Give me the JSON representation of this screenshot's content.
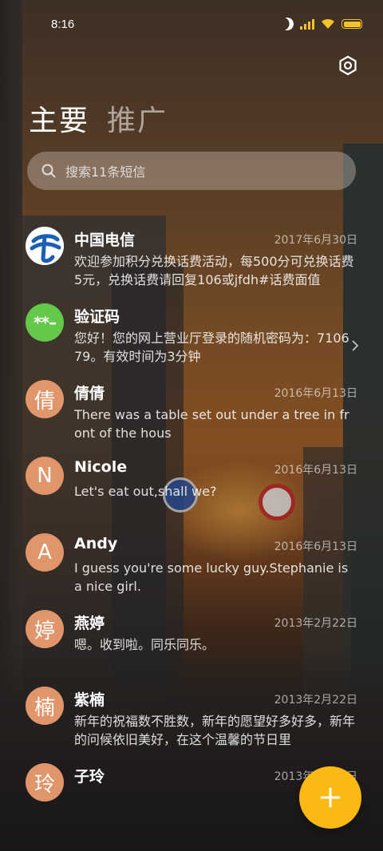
{
  "status_bar": {
    "time": "8:16",
    "icons": [
      "moon-icon",
      "signal-icon",
      "wifi-icon",
      "battery-icon"
    ],
    "accent_color": "#f5c22a"
  },
  "header": {
    "settings_icon": "gear-icon",
    "tabs": [
      {
        "label": "主要",
        "active": true
      },
      {
        "label": "推广",
        "active": false
      }
    ]
  },
  "search": {
    "placeholder": "搜索11条短信",
    "icon": "search-icon"
  },
  "messages": [
    {
      "avatar_text": "",
      "avatar_type": "telecom-logo",
      "name": "中国电信",
      "date": "2017年6月30日",
      "snippet": "欢迎参加积分兑换话费活动，每500分可兑换话费5元，兑换话费请回复106或jfdh#话费面值"
    },
    {
      "avatar_text": "**–",
      "avatar_type": "verification",
      "name": "验证码",
      "date": "",
      "snippet": "您好！您的网上营业厅登录的随机密码为：710679。有效时间为3分钟",
      "has_chevron": true
    },
    {
      "avatar_text": "倩",
      "avatar_type": "person",
      "name": "倩倩",
      "date": "2016年6月13日",
      "snippet": "There was a table set out under a tree in front of the hous"
    },
    {
      "avatar_text": "N",
      "avatar_type": "person",
      "name": "Nicole",
      "date": "2016年6月13日",
      "snippet": "Let's eat out,shall we?"
    },
    {
      "avatar_text": "A",
      "avatar_type": "person",
      "name": "Andy",
      "date": "2016年6月13日",
      "snippet": "I guess you're some lucky guy.Stephanie is a nice girl."
    },
    {
      "avatar_text": "婷",
      "avatar_type": "person",
      "name": "燕婷",
      "date": "2013年2月22日",
      "snippet": "嗯。收到啦。同乐同乐。"
    },
    {
      "avatar_text": "楠",
      "avatar_type": "person",
      "name": "紫楠",
      "date": "2013年2月22日",
      "snippet": "新年的祝福数不胜数，新年的愿望好多好多，新年的问候依旧美好，在这个温馨的节日里"
    },
    {
      "avatar_text": "玲",
      "avatar_type": "person",
      "name": "子玲",
      "date": "2013年2月22日",
      "snippet": ""
    }
  ],
  "fab": {
    "icon": "plus-icon",
    "color": "#fbb914"
  }
}
